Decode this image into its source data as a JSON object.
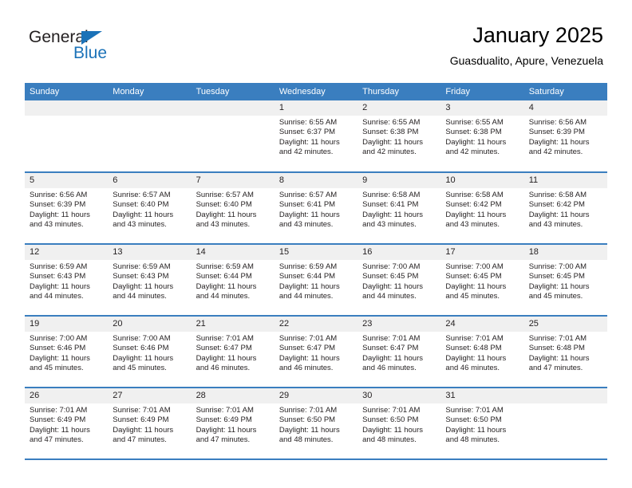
{
  "brand": {
    "name_part1": "General",
    "name_part2": "Blue",
    "accent_color": "#1b72b8"
  },
  "header": {
    "title": "January 2025",
    "subtitle": "Guasdualito, Apure, Venezuela"
  },
  "calendar": {
    "header_bg": "#3a7ebf",
    "daynum_bg": "#f0f0f0",
    "weekday_headers": [
      "Sunday",
      "Monday",
      "Tuesday",
      "Wednesday",
      "Thursday",
      "Friday",
      "Saturday"
    ],
    "weeks": [
      [
        {
          "day": "",
          "sunrise": "",
          "sunset": "",
          "daylight": ""
        },
        {
          "day": "",
          "sunrise": "",
          "sunset": "",
          "daylight": ""
        },
        {
          "day": "",
          "sunrise": "",
          "sunset": "",
          "daylight": ""
        },
        {
          "day": "1",
          "sunrise": "Sunrise: 6:55 AM",
          "sunset": "Sunset: 6:37 PM",
          "daylight": "Daylight: 11 hours and 42 minutes."
        },
        {
          "day": "2",
          "sunrise": "Sunrise: 6:55 AM",
          "sunset": "Sunset: 6:38 PM",
          "daylight": "Daylight: 11 hours and 42 minutes."
        },
        {
          "day": "3",
          "sunrise": "Sunrise: 6:55 AM",
          "sunset": "Sunset: 6:38 PM",
          "daylight": "Daylight: 11 hours and 42 minutes."
        },
        {
          "day": "4",
          "sunrise": "Sunrise: 6:56 AM",
          "sunset": "Sunset: 6:39 PM",
          "daylight": "Daylight: 11 hours and 42 minutes."
        }
      ],
      [
        {
          "day": "5",
          "sunrise": "Sunrise: 6:56 AM",
          "sunset": "Sunset: 6:39 PM",
          "daylight": "Daylight: 11 hours and 43 minutes."
        },
        {
          "day": "6",
          "sunrise": "Sunrise: 6:57 AM",
          "sunset": "Sunset: 6:40 PM",
          "daylight": "Daylight: 11 hours and 43 minutes."
        },
        {
          "day": "7",
          "sunrise": "Sunrise: 6:57 AM",
          "sunset": "Sunset: 6:40 PM",
          "daylight": "Daylight: 11 hours and 43 minutes."
        },
        {
          "day": "8",
          "sunrise": "Sunrise: 6:57 AM",
          "sunset": "Sunset: 6:41 PM",
          "daylight": "Daylight: 11 hours and 43 minutes."
        },
        {
          "day": "9",
          "sunrise": "Sunrise: 6:58 AM",
          "sunset": "Sunset: 6:41 PM",
          "daylight": "Daylight: 11 hours and 43 minutes."
        },
        {
          "day": "10",
          "sunrise": "Sunrise: 6:58 AM",
          "sunset": "Sunset: 6:42 PM",
          "daylight": "Daylight: 11 hours and 43 minutes."
        },
        {
          "day": "11",
          "sunrise": "Sunrise: 6:58 AM",
          "sunset": "Sunset: 6:42 PM",
          "daylight": "Daylight: 11 hours and 43 minutes."
        }
      ],
      [
        {
          "day": "12",
          "sunrise": "Sunrise: 6:59 AM",
          "sunset": "Sunset: 6:43 PM",
          "daylight": "Daylight: 11 hours and 44 minutes."
        },
        {
          "day": "13",
          "sunrise": "Sunrise: 6:59 AM",
          "sunset": "Sunset: 6:43 PM",
          "daylight": "Daylight: 11 hours and 44 minutes."
        },
        {
          "day": "14",
          "sunrise": "Sunrise: 6:59 AM",
          "sunset": "Sunset: 6:44 PM",
          "daylight": "Daylight: 11 hours and 44 minutes."
        },
        {
          "day": "15",
          "sunrise": "Sunrise: 6:59 AM",
          "sunset": "Sunset: 6:44 PM",
          "daylight": "Daylight: 11 hours and 44 minutes."
        },
        {
          "day": "16",
          "sunrise": "Sunrise: 7:00 AM",
          "sunset": "Sunset: 6:45 PM",
          "daylight": "Daylight: 11 hours and 44 minutes."
        },
        {
          "day": "17",
          "sunrise": "Sunrise: 7:00 AM",
          "sunset": "Sunset: 6:45 PM",
          "daylight": "Daylight: 11 hours and 45 minutes."
        },
        {
          "day": "18",
          "sunrise": "Sunrise: 7:00 AM",
          "sunset": "Sunset: 6:45 PM",
          "daylight": "Daylight: 11 hours and 45 minutes."
        }
      ],
      [
        {
          "day": "19",
          "sunrise": "Sunrise: 7:00 AM",
          "sunset": "Sunset: 6:46 PM",
          "daylight": "Daylight: 11 hours and 45 minutes."
        },
        {
          "day": "20",
          "sunrise": "Sunrise: 7:00 AM",
          "sunset": "Sunset: 6:46 PM",
          "daylight": "Daylight: 11 hours and 45 minutes."
        },
        {
          "day": "21",
          "sunrise": "Sunrise: 7:01 AM",
          "sunset": "Sunset: 6:47 PM",
          "daylight": "Daylight: 11 hours and 46 minutes."
        },
        {
          "day": "22",
          "sunrise": "Sunrise: 7:01 AM",
          "sunset": "Sunset: 6:47 PM",
          "daylight": "Daylight: 11 hours and 46 minutes."
        },
        {
          "day": "23",
          "sunrise": "Sunrise: 7:01 AM",
          "sunset": "Sunset: 6:47 PM",
          "daylight": "Daylight: 11 hours and 46 minutes."
        },
        {
          "day": "24",
          "sunrise": "Sunrise: 7:01 AM",
          "sunset": "Sunset: 6:48 PM",
          "daylight": "Daylight: 11 hours and 46 minutes."
        },
        {
          "day": "25",
          "sunrise": "Sunrise: 7:01 AM",
          "sunset": "Sunset: 6:48 PM",
          "daylight": "Daylight: 11 hours and 47 minutes."
        }
      ],
      [
        {
          "day": "26",
          "sunrise": "Sunrise: 7:01 AM",
          "sunset": "Sunset: 6:49 PM",
          "daylight": "Daylight: 11 hours and 47 minutes."
        },
        {
          "day": "27",
          "sunrise": "Sunrise: 7:01 AM",
          "sunset": "Sunset: 6:49 PM",
          "daylight": "Daylight: 11 hours and 47 minutes."
        },
        {
          "day": "28",
          "sunrise": "Sunrise: 7:01 AM",
          "sunset": "Sunset: 6:49 PM",
          "daylight": "Daylight: 11 hours and 47 minutes."
        },
        {
          "day": "29",
          "sunrise": "Sunrise: 7:01 AM",
          "sunset": "Sunset: 6:50 PM",
          "daylight": "Daylight: 11 hours and 48 minutes."
        },
        {
          "day": "30",
          "sunrise": "Sunrise: 7:01 AM",
          "sunset": "Sunset: 6:50 PM",
          "daylight": "Daylight: 11 hours and 48 minutes."
        },
        {
          "day": "31",
          "sunrise": "Sunrise: 7:01 AM",
          "sunset": "Sunset: 6:50 PM",
          "daylight": "Daylight: 11 hours and 48 minutes."
        },
        {
          "day": "",
          "sunrise": "",
          "sunset": "",
          "daylight": ""
        }
      ]
    ]
  }
}
